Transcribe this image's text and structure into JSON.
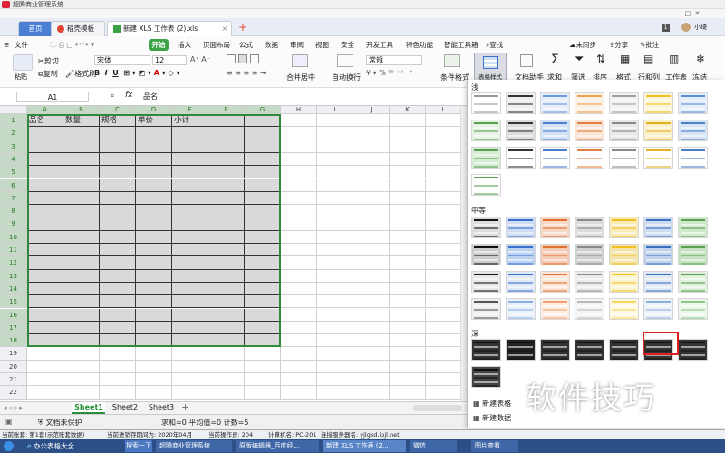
{
  "window": {
    "title": "超腾商业管理系统"
  },
  "tabs": [
    {
      "label": "首页"
    },
    {
      "label": "稻壳模板"
    },
    {
      "label": "新建 XLS 工作表 (2).xls"
    }
  ],
  "user": {
    "name": "小琦",
    "badge": "1"
  },
  "menu": {
    "file": "文件",
    "start": "开始",
    "items": [
      "插入",
      "页面布局",
      "公式",
      "数据",
      "审阅",
      "视图",
      "安全",
      "开发工具",
      "特色功能",
      "智能工具箱"
    ],
    "search": "查找",
    "sync": "未同步",
    "share": "分享",
    "comment": "批注"
  },
  "toolbar": {
    "paste": "粘贴",
    "cut": "剪切",
    "copy": "复制",
    "format_painter": "格式刷",
    "font": "宋体",
    "font_size": "12",
    "merge": "合并居中",
    "wrap": "自动换行",
    "number_format": "常规",
    "cond_format": "条件格式",
    "table_style": "表格样式",
    "doc_helper": "文档助手",
    "sum": "求和",
    "filter": "筛选",
    "sort": "排序",
    "format": "格式",
    "rowcol": "行和列",
    "worksheet": "工作表",
    "freeze": "冻结"
  },
  "formula": {
    "cell_ref": "A1",
    "fx": "fx",
    "content": "品名"
  },
  "columns": [
    "A",
    "B",
    "C",
    "D",
    "E",
    "F",
    "G",
    "H",
    "I",
    "J",
    "K",
    "L"
  ],
  "rows": [
    "1",
    "2",
    "3",
    "4",
    "5",
    "6",
    "7",
    "8",
    "9",
    "10",
    "11",
    "12",
    "13",
    "14",
    "15",
    "16",
    "17",
    "18",
    "19",
    "20",
    "21",
    "22"
  ],
  "cells": {
    "row1": [
      "品名",
      "数量",
      "规格",
      "单价",
      "小计"
    ]
  },
  "sheets": [
    "Sheet1",
    "Sheet2",
    "Sheet3"
  ],
  "status": {
    "protect": "文档未保护",
    "summary": "求和=0  平均值=0  计数=5"
  },
  "panel": {
    "light": "浅",
    "medium": "中等",
    "dark": "深",
    "new_style": "新建表格",
    "new_data": "新建数据"
  },
  "infobar": [
    "当前账套: 第1套(示范账套数据)",
    "当前进销存期间为: 2020年04月",
    "当前操作员: 204",
    "计算机名: PC-201",
    "连接服务器名: yjlgsd.ipjl.net"
  ],
  "taskbar": {
    "start": "办公表格大全",
    "items": [
      "搜索一下",
      "超腾商业管理系统",
      "原版编辑器_百度经...",
      "新建 XLS 工作表 (2...",
      "微信",
      "图片查看"
    ]
  },
  "watermark": "软件技巧",
  "colors": {
    "accent": "#3aa347",
    "selection": "#d9d9d9",
    "selection_border": "#2e8b3a",
    "taskbar": "#2b4f86"
  }
}
